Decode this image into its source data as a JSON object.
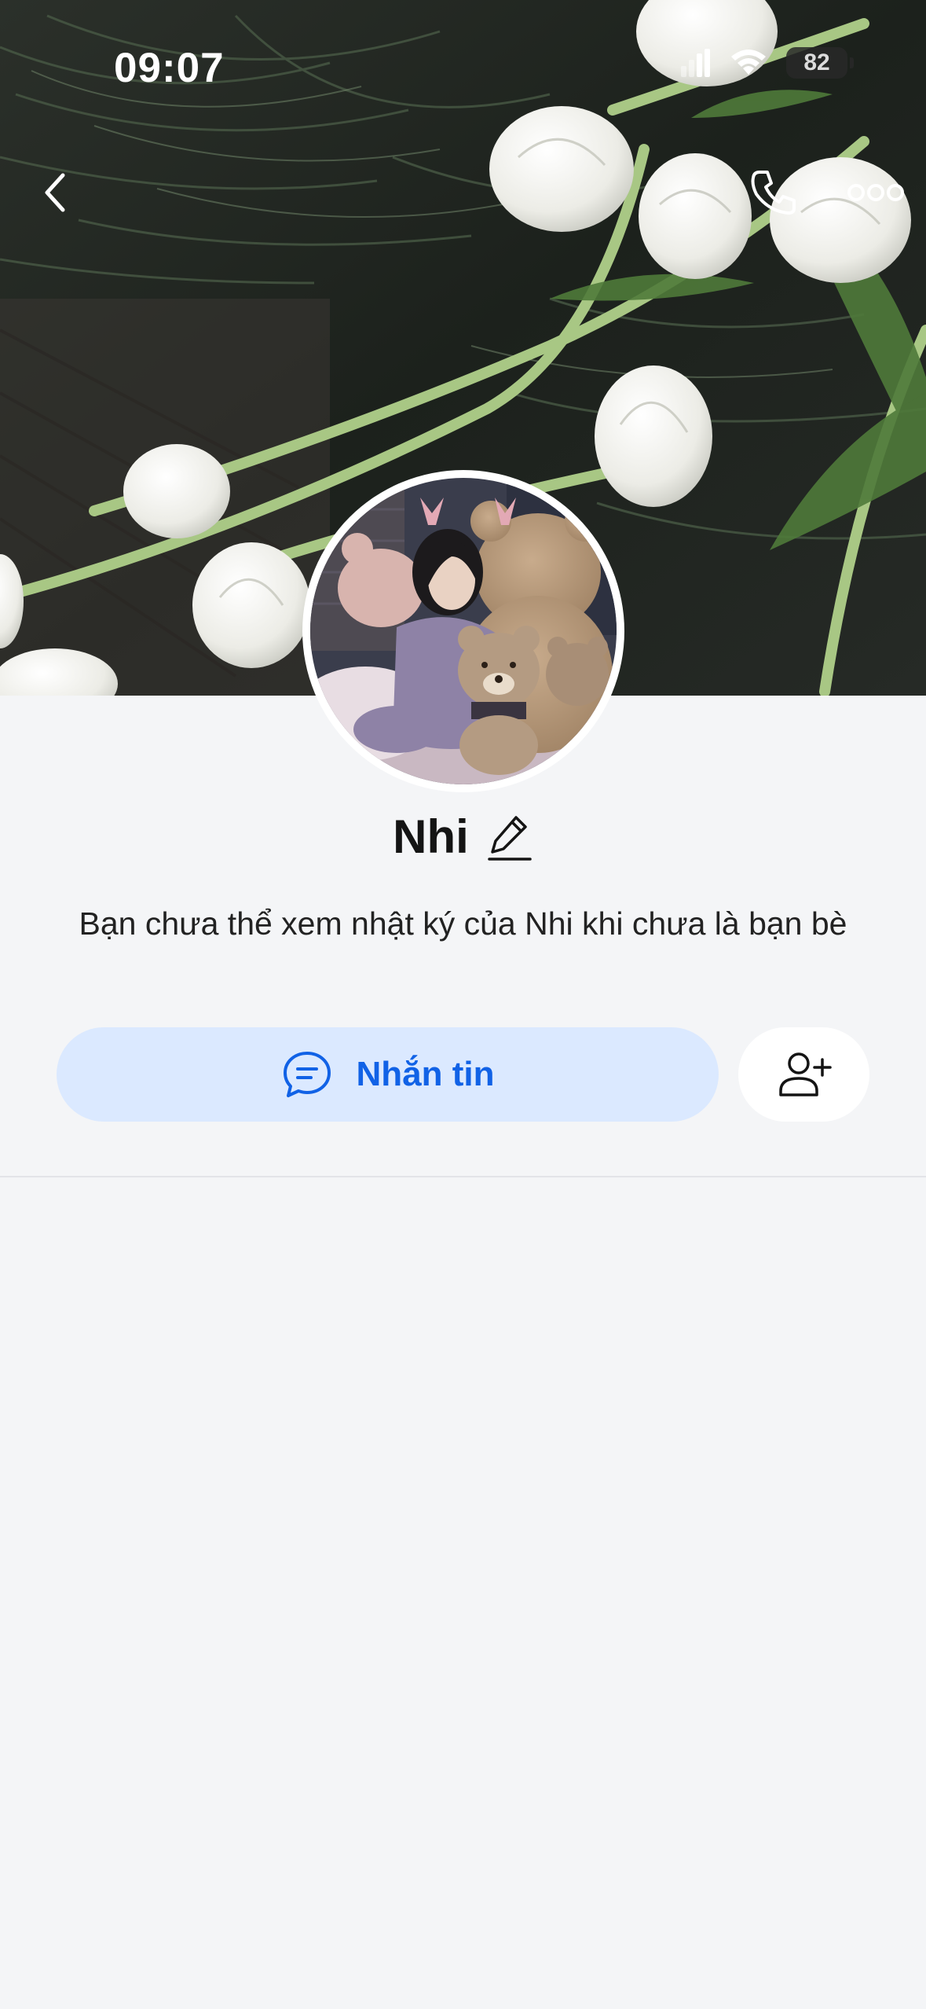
{
  "status_bar": {
    "time": "09:07",
    "battery": "82",
    "icons": [
      "signal-icon",
      "wifi-icon",
      "battery-icon"
    ]
  },
  "header": {
    "back_icon": "chevron-left-icon",
    "call_icon": "phone-icon",
    "more_icon": "more-dots-icon"
  },
  "profile": {
    "name": "Nhi",
    "edit_icon": "pencil-icon",
    "description": "Bạn chưa thể xem nhật ký của Nhi khi chưa là bạn bè"
  },
  "actions": {
    "message_label": "Nhắn tin",
    "message_icon": "chat-bubble-icon",
    "add_friend_icon": "add-user-icon"
  },
  "colors": {
    "background": "#f4f5f7",
    "accent": "#1162e6",
    "message_button_bg": "#dbe9ff"
  }
}
